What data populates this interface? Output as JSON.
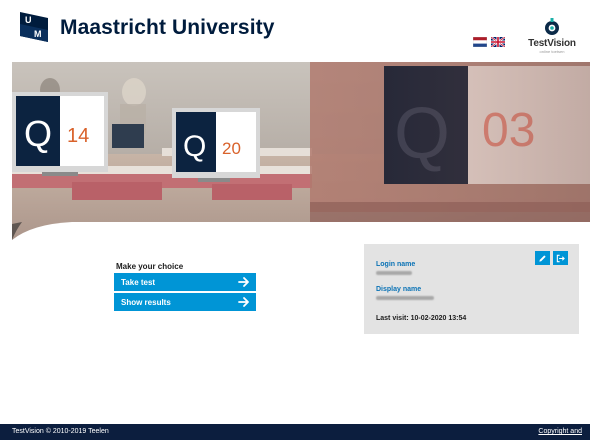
{
  "header": {
    "brand": "Maastricht University",
    "logo_letters": [
      "U",
      "M"
    ],
    "languages": [
      "nl",
      "en"
    ],
    "tv_logo": {
      "name": "TestVision",
      "tagline": "online toetsen"
    }
  },
  "hero": {
    "signs": [
      {
        "letter": "Q",
        "number": "14"
      },
      {
        "letter": "Q",
        "number": "20"
      },
      {
        "letter": "Q",
        "number": "03"
      }
    ]
  },
  "choice": {
    "title": "Make your choice",
    "take_test": "Take test",
    "show_results": "Show results"
  },
  "info": {
    "login_label": "Login name",
    "display_label": "Display name",
    "last_visit": "Last visit: 10-02-2020 13:54"
  },
  "footer": {
    "left": "TestVision © 2010-2019 Teelen",
    "right": "Copyright and"
  },
  "colors": {
    "navy": "#001c3d",
    "accent": "#0095d6",
    "label_blue": "#0a72b5",
    "footer_bg": "#0c1e3e",
    "info_bg": "#e3e3e3"
  }
}
